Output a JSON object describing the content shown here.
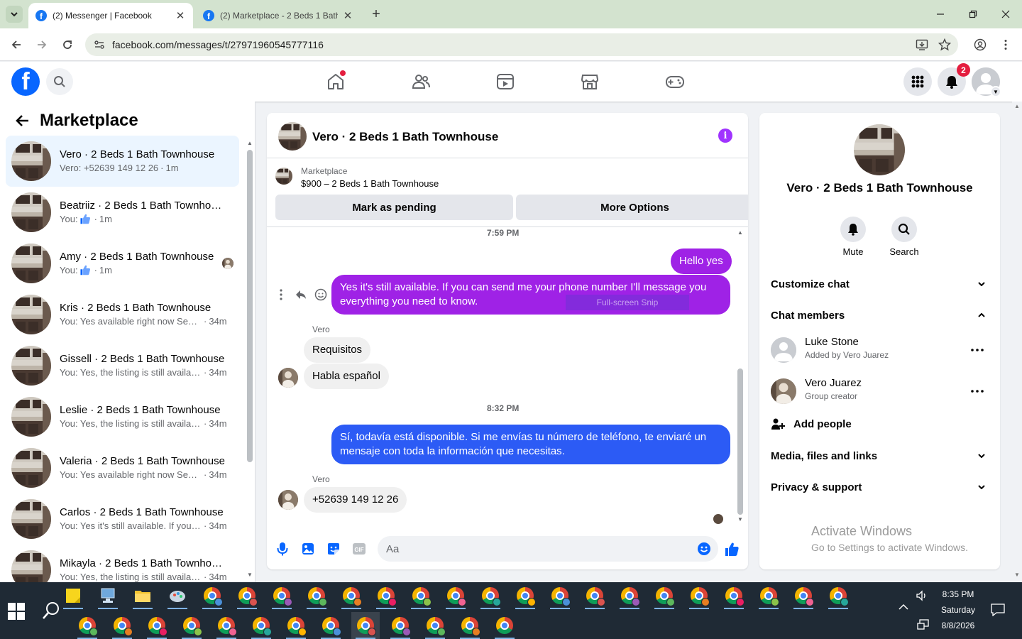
{
  "browser": {
    "tabs": [
      {
        "title": "(2) Messenger | Facebook",
        "active": true
      },
      {
        "title": "(2) Marketplace - 2 Beds 1 Bath",
        "active": false
      }
    ],
    "url": "facebook.com/messages/t/27971960545777116"
  },
  "header": {
    "notifications_count": "2",
    "home_has_dot": true
  },
  "sidebar": {
    "title": "Marketplace",
    "conversations": [
      {
        "name": "Vero · 2 Beds 1 Bath Townhouse",
        "snippet": "Vero: +52639 149 12 26",
        "time": "1m",
        "active": true,
        "like": false
      },
      {
        "name": "Beatriiz · 2 Beds 1 Bath Townhouse",
        "snippet": "You:",
        "time": "1m",
        "active": false,
        "like": true
      },
      {
        "name": "Amy · 2 Beds 1 Bath Townhouse",
        "snippet": "You:",
        "time": "1m",
        "active": false,
        "like": true
      },
      {
        "name": "Kris · 2 Beds 1 Bath Townhouse",
        "snippet": "You: Yes available right now Send...",
        "time": "34m",
        "active": false,
        "like": false
      },
      {
        "name": "Gissell · 2 Beds 1 Bath Townhouse",
        "snippet": "You: Yes, the listing is still availabl...",
        "time": "34m",
        "active": false,
        "like": false
      },
      {
        "name": "Leslie · 2 Beds 1 Bath Townhouse",
        "snippet": "You: Yes, the listing is still availabl...",
        "time": "34m",
        "active": false,
        "like": false
      },
      {
        "name": "Valeria · 2 Beds 1 Bath Townhouse",
        "snippet": "You: Yes available right now Send...",
        "time": "34m",
        "active": false,
        "like": false
      },
      {
        "name": "Carlos · 2 Beds 1 Bath Townhouse",
        "snippet": "You: Yes it's still available. If you c...",
        "time": "34m",
        "active": false,
        "like": false
      },
      {
        "name": "Mikayla · 2 Beds 1 Bath Townhouse",
        "snippet": "You: Yes, the listing is still availabl...",
        "time": "34m",
        "active": false,
        "like": false
      }
    ]
  },
  "chat": {
    "title": "Vero · 2 Beds 1 Bath Townhouse",
    "marketplace_label": "Marketplace",
    "listing": "$900 – 2 Beds 1 Bath Townhouse",
    "mark_pending": "Mark as pending",
    "more_options": "More Options",
    "time1": "7:59 PM",
    "msg_hello": "Hello yes",
    "msg_available_en": "Yes it's still available. If you can send me your phone number I'll message you everything you need to know.",
    "snip_label": "Full-screen Snip",
    "sender1": "Vero",
    "msg_requisitos": "Requisitos",
    "msg_habla": "Habla español",
    "time2": "8:32 PM",
    "msg_available_es": "Sí, todavía está disponible. Si me envías tu número de teléfono, te enviaré un mensaje con toda la información que necesitas.",
    "sender2": "Vero",
    "msg_phone": "+52639 149 12 26",
    "composer_placeholder": "Aa",
    "accent": "#9f22e6"
  },
  "info_panel": {
    "title": "Vero · 2 Beds 1 Bath Townhouse",
    "mute": "Mute",
    "search": "Search",
    "customize_chat": "Customize chat",
    "chat_members": "Chat members",
    "members": [
      {
        "name": "Luke Stone",
        "sub": "Added by Vero Juarez"
      },
      {
        "name": "Vero Juarez",
        "sub": "Group creator"
      }
    ],
    "add_people": "Add people",
    "media": "Media, files and links",
    "privacy": "Privacy & support"
  },
  "watermark": {
    "line1": "Activate Windows",
    "line2": "Go to Settings to activate Windows."
  },
  "taskbar": {
    "time": "8:35 PM",
    "day": "Saturday",
    "date": "8/8/2026"
  }
}
